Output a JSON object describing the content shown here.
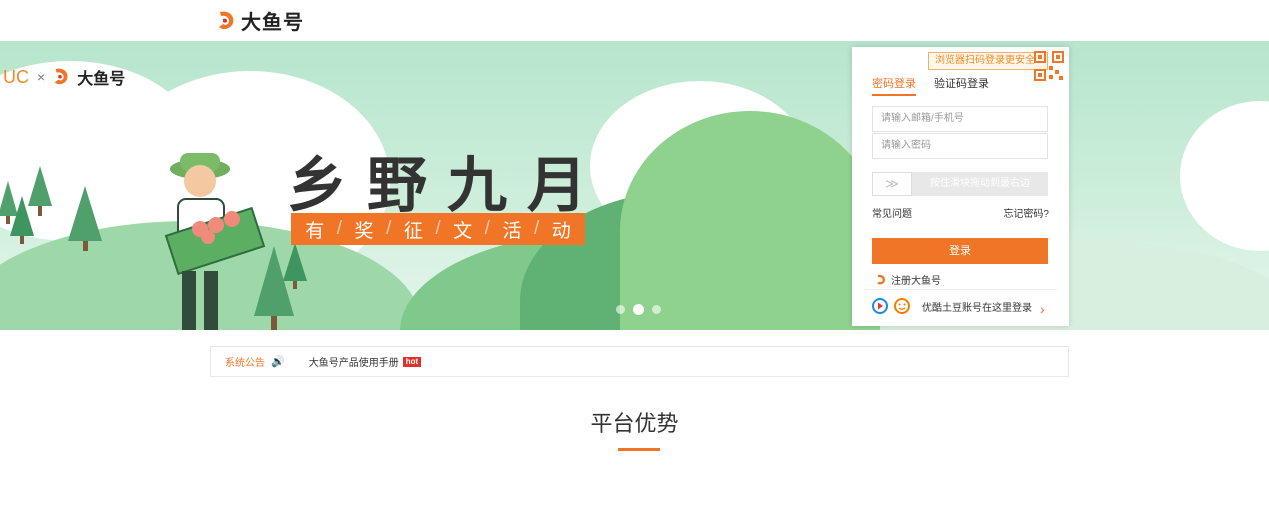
{
  "header": {
    "brand_name": "大鱼号"
  },
  "banner": {
    "partner_logo": "UC",
    "cross": "×",
    "partner_brand": "大鱼号",
    "headline": "乡野九月",
    "subline": [
      "有",
      "奖",
      "征",
      "文",
      "活",
      "动"
    ],
    "carousel": {
      "count": 3,
      "active_index": 1
    }
  },
  "login": {
    "qr_tip": "浏览器扫码登录更安全",
    "tabs": [
      {
        "label": "密码登录",
        "active": true
      },
      {
        "label": "验证码登录",
        "active": false
      }
    ],
    "email_placeholder": "请输入邮箱/手机号",
    "password_placeholder": "请输入密码",
    "slider_text": "按住滑块拖动到最右边",
    "faq_link": "常见问题",
    "forgot_link": "忘记密码?",
    "submit_label": "登录",
    "register_label": "注册大鱼号",
    "third_party_label": "优酷土豆账号在这里登录"
  },
  "notice": {
    "label": "系统公告",
    "text": "大鱼号产品使用手册",
    "badge": "hot"
  },
  "section": {
    "title": "平台优势"
  },
  "colors": {
    "accent": "#f07526",
    "banner_bg": "#b7e5cc"
  }
}
